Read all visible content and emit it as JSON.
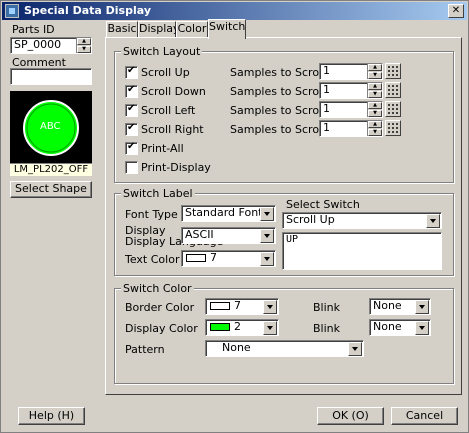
{
  "window": {
    "title": "Special Data Display"
  },
  "left": {
    "parts_id_label": "Parts ID",
    "parts_id_value": "SP_0000",
    "comment_label": "Comment",
    "comment_value": "",
    "preview_text": "ABC",
    "shape_name": "LM_PL202_OFF",
    "select_shape_label": "Select Shape"
  },
  "tabs": [
    {
      "label": "Basic"
    },
    {
      "label": "Display"
    },
    {
      "label": "Color"
    },
    {
      "label": "Switch",
      "active": true
    }
  ],
  "switch_layout": {
    "title": "Switch Layout",
    "samples_label": "Samples to Scroll",
    "items": [
      {
        "label": "Scroll Up",
        "checked": true,
        "samples": "1"
      },
      {
        "label": "Scroll Down",
        "checked": true,
        "samples": "1"
      },
      {
        "label": "Scroll Left",
        "checked": true,
        "samples": "1"
      },
      {
        "label": "Scroll Right",
        "checked": true,
        "samples": "1"
      }
    ],
    "print_all": {
      "label": "Print-All",
      "checked": true
    },
    "print_display": {
      "label": "Print-Display",
      "checked": false
    }
  },
  "switch_label": {
    "title": "Switch Label",
    "font_type_label": "Font Type",
    "font_type_value": "Standard Font",
    "display_language_label": "Display Language",
    "display_language_value": "ASCII",
    "text_color_label": "Text Color",
    "text_color_value": "7",
    "text_color_swatch": "#ffffff",
    "select_switch_label": "Select Switch",
    "select_switch_value": "Scroll Up",
    "label_text": "UP"
  },
  "switch_color": {
    "title": "Switch Color",
    "border_color_label": "Border Color",
    "border_color_value": "7",
    "border_color_swatch": "#ffffff",
    "display_color_label": "Display Color",
    "display_color_value": "2",
    "display_color_swatch": "#00ff00",
    "blink_label": "Blink",
    "blink1_value": "None",
    "blink2_value": "None",
    "pattern_label": "Pattern",
    "pattern_value": "None"
  },
  "buttons": {
    "help": "Help (H)",
    "ok": "OK (O)",
    "cancel": "Cancel"
  },
  "colors": {
    "title_start": "#0a246a",
    "title_end": "#a6caf0",
    "preview_circle": "#00ff00",
    "shape_name_bg": "#ffffe1"
  }
}
